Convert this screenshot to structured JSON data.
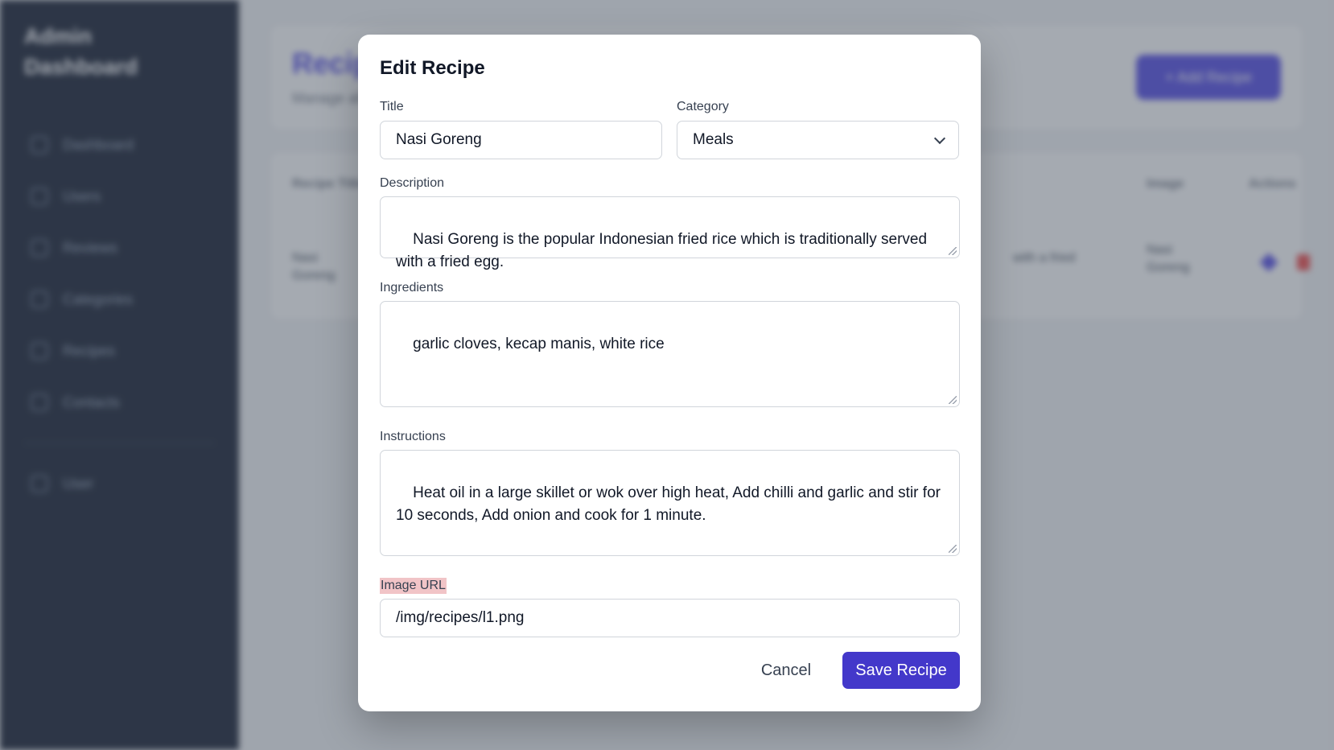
{
  "sidebar": {
    "brand": "Admin Dashboard",
    "items": [
      {
        "label": "Dashboard",
        "icon": "home-icon"
      },
      {
        "label": "Users",
        "icon": "user-icon"
      },
      {
        "label": "Reviews",
        "icon": "star-icon"
      },
      {
        "label": "Categories",
        "icon": "folder-icon"
      },
      {
        "label": "Recipes",
        "icon": "book-icon"
      },
      {
        "label": "Contacts",
        "icon": "chat-icon"
      }
    ],
    "user_item": {
      "label": "User",
      "icon": "account-icon"
    }
  },
  "page": {
    "title": "Recipes",
    "subtitle": "Manage all recipes",
    "add_button": "+ Add Recipe"
  },
  "table": {
    "headers": [
      "Recipe Title",
      "Image",
      "Actions"
    ],
    "row": {
      "title": "Nasi Goreng",
      "description_snippet": "with a fried",
      "image_alt": "Nasi Goreng"
    }
  },
  "modal": {
    "title": "Edit Recipe",
    "fields": {
      "title": {
        "label": "Title",
        "value": "Nasi Goreng"
      },
      "category": {
        "label": "Category",
        "value": "Meals"
      },
      "description": {
        "label": "Description",
        "value": "Nasi Goreng is the popular Indonesian fried rice which is traditionally served with a fried egg."
      },
      "ingredients": {
        "label": "Ingredients",
        "value": "garlic cloves, kecap manis, white rice"
      },
      "instructions": {
        "label": "Instructions",
        "value": "Heat oil in a large skillet or wok over high heat, Add chilli and garlic and stir for 10 seconds, Add onion and cook for 1 minute."
      },
      "image_url": {
        "label": "Image URL",
        "value": "/img/recipes/l1.png"
      }
    },
    "cancel_label": "Cancel",
    "save_label": "Save Recipe"
  },
  "colors": {
    "sidebar_bg": "#0f172a",
    "accent": "#4338ca",
    "highlight": "#f1c4c7"
  }
}
